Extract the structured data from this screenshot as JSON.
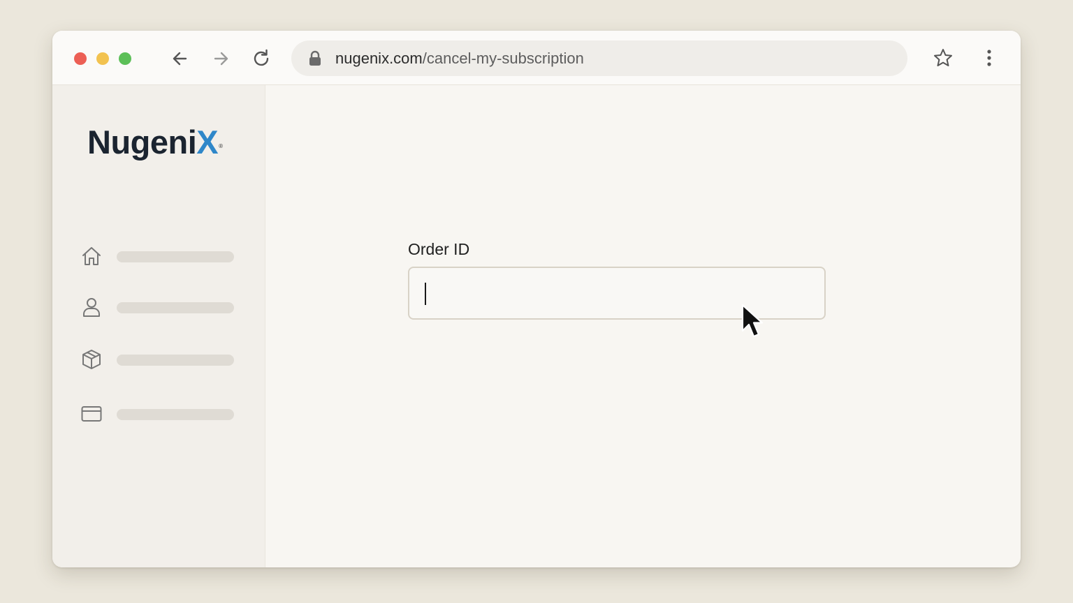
{
  "browser": {
    "url_domain": "nugenix.com",
    "url_path": "/cancel-my-subscription",
    "icons": [
      "back-arrow-icon",
      "forward-arrow-icon",
      "reload-icon",
      "lock-icon",
      "star-icon",
      "kebab-menu-icon"
    ]
  },
  "sidebar": {
    "logo": {
      "main": "Nugeni",
      "accent": "X",
      "registered": "®"
    },
    "items": [
      {
        "icon": "home-icon"
      },
      {
        "icon": "user-icon"
      },
      {
        "icon": "box-icon"
      },
      {
        "icon": "credit-card-icon"
      }
    ]
  },
  "form": {
    "order_label": "Order ID",
    "order_value": ""
  },
  "colors": {
    "background": "#ebe7dc",
    "logo_text": "#1b2430",
    "logo_accent": "#2f87c9",
    "close": "#ec5f55",
    "minimize": "#f2c24f",
    "maximize": "#5cbf58"
  }
}
